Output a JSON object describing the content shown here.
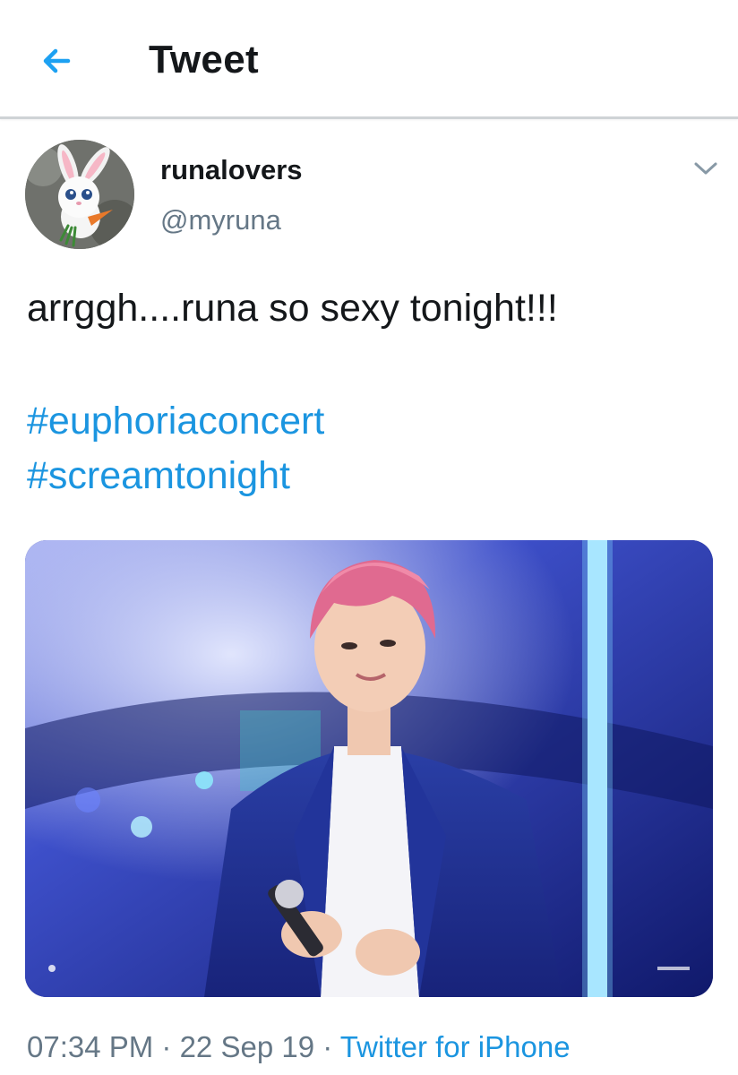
{
  "header": {
    "back_icon": "arrow-left-icon",
    "title": "Tweet",
    "accent": "#1da1f2"
  },
  "author": {
    "display_name": "runalovers",
    "handle": "@myruna",
    "avatar": "bunny-avatar"
  },
  "menu_icon": "chevron-down-icon",
  "tweet": {
    "text": "arrggh....runa so sexy tonight!!!",
    "hashtags": [
      "#euphoriaconcert",
      "#screamtonight"
    ]
  },
  "media": {
    "type": "photo",
    "description_icon": "concert-photo"
  },
  "meta": {
    "time": "07:34 PM",
    "separator": " · ",
    "date": "22 Sep 19",
    "source": "Twitter for iPhone"
  },
  "colors": {
    "link": "#1b95e0",
    "secondary_text": "#657786",
    "primary_text": "#14171a"
  }
}
